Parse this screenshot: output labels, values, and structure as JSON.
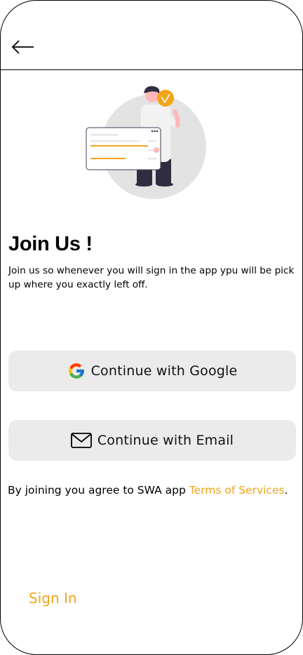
{
  "header": {
    "back_icon": "arrow-left-icon"
  },
  "hero": {
    "illustration": "person-with-checkmark-illustration",
    "accent_color": "#f2a51a"
  },
  "intro": {
    "title": "Join Us !",
    "description": "Join us so whenever you will sign in the app ypu will be pick up where you exactly left off."
  },
  "buttons": {
    "google": {
      "label": "Continue with Google",
      "icon": "google-icon"
    },
    "email": {
      "label": "Continue with Email",
      "icon": "envelope-icon"
    }
  },
  "terms": {
    "prefix": "By joining you agree to SWA app ",
    "link": "Terms of Services",
    "suffix": "."
  },
  "footer": {
    "signin_label": "Sign In"
  },
  "colors": {
    "accent": "#f2a51a",
    "button_bg": "#ebebeb"
  }
}
